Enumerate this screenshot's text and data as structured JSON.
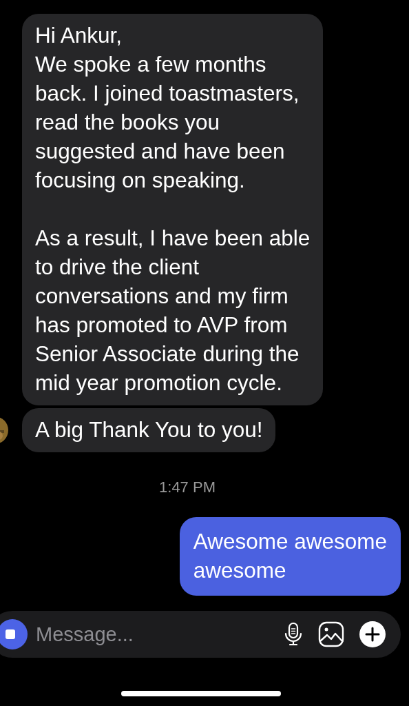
{
  "messages": [
    {
      "kind": "received",
      "show_avatar": false,
      "text": "Hi Ankur,\nWe spoke a few months\nback. I joined toastmasters,\nread the books you\nsuggested and have been\nfocusing on speaking.\n\nAs a result, I have been able\nto drive the client\nconversations and my firm\nhas promoted to AVP from\nSenior Associate during the\nmid year promotion cycle."
    },
    {
      "kind": "received",
      "show_avatar": true,
      "text": "A big Thank You to you!"
    },
    {
      "kind": "time",
      "text": "1:47 PM"
    },
    {
      "kind": "sent",
      "text": "Awesome awesome\nawesome"
    }
  ],
  "composer": {
    "placeholder": "Message..."
  }
}
